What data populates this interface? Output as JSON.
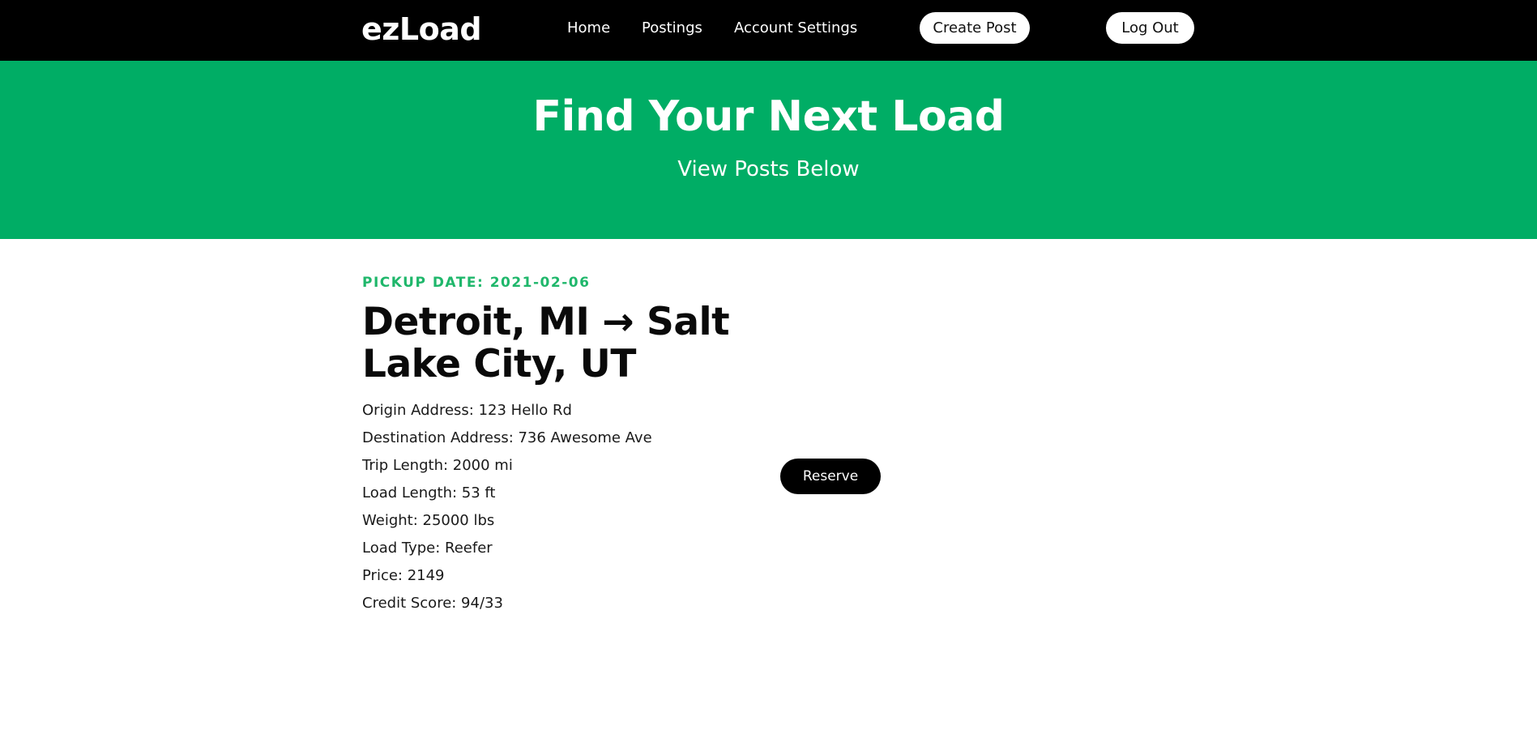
{
  "nav": {
    "logo": "ezLoad",
    "links": [
      "Home",
      "Postings",
      "Account Settings"
    ],
    "create_post": "Create Post",
    "log_out": "Log Out"
  },
  "hero": {
    "title": "Find Your Next Load",
    "subtitle": "View Posts Below"
  },
  "post": {
    "pickup_date": "PICKUP DATE: 2021-02-06",
    "route": "Detroit, MI → Salt Lake City, UT",
    "details": [
      "Origin Address: 123 Hello Rd",
      "Destination Address: 736 Awesome Ave",
      "Trip Length: 2000 mi",
      "Load Length: 53 ft",
      "Weight: 25000 lbs",
      "Load Type: Reefer",
      "Price: 2149",
      "Credit Score: 94/33"
    ],
    "reserve": "Reserve"
  },
  "colors": {
    "nav_bg": "#000000",
    "hero_bg": "#00ad65",
    "accent": "#1fb76b"
  }
}
